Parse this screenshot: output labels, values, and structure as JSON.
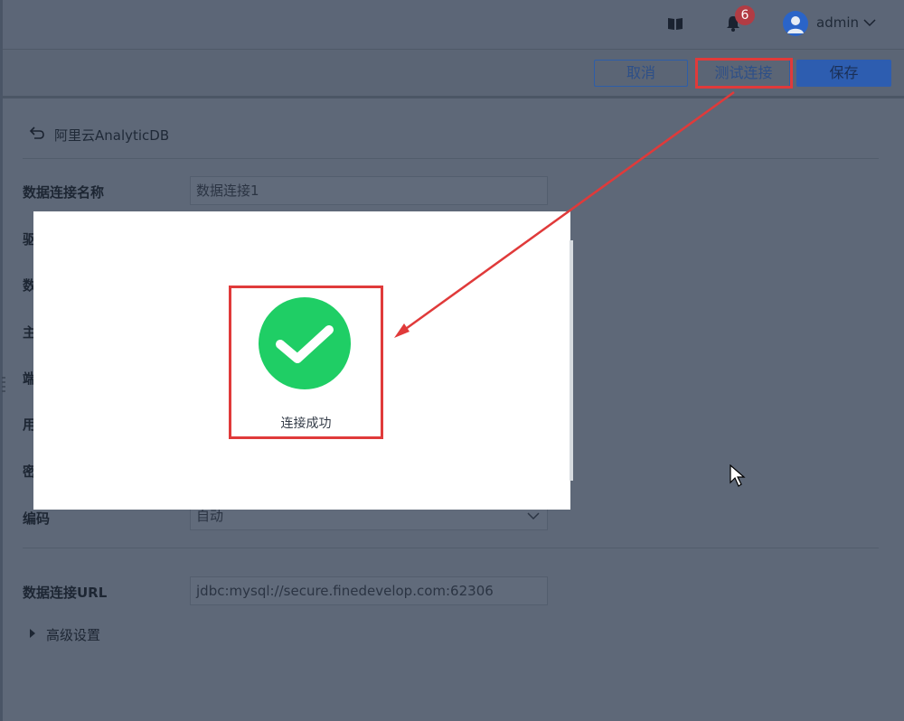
{
  "header": {
    "notifications": {
      "count": "6"
    },
    "user": {
      "name": "admin"
    }
  },
  "toolbar": {
    "cancel_label": "取消",
    "test_label": "测试连接",
    "save_label": "保存"
  },
  "connection": {
    "title": "阿里云AnalyticDB"
  },
  "form": {
    "name": {
      "label": "数据连接名称",
      "value": "数据连接1"
    },
    "hidden_labels": [
      "驱",
      "数",
      "主",
      "端",
      "用",
      "密"
    ],
    "encoding": {
      "label": "编码",
      "value": "自动"
    },
    "url": {
      "label": "数据连接URL",
      "value": "jdbc:mysql://secure.finedevelop.com:62306"
    },
    "advanced": {
      "label": "高级设置"
    }
  },
  "modal": {
    "message": "连接成功"
  },
  "colors": {
    "success_green": "#1fce65",
    "highlight_red": "#e03a3a",
    "primary_blue": "#2d5db0"
  },
  "icons": [
    "book-icon",
    "bell-icon",
    "user-avatar-icon",
    "chevron-down-icon",
    "back-arrow-icon",
    "check-icon",
    "cursor-icon"
  ]
}
